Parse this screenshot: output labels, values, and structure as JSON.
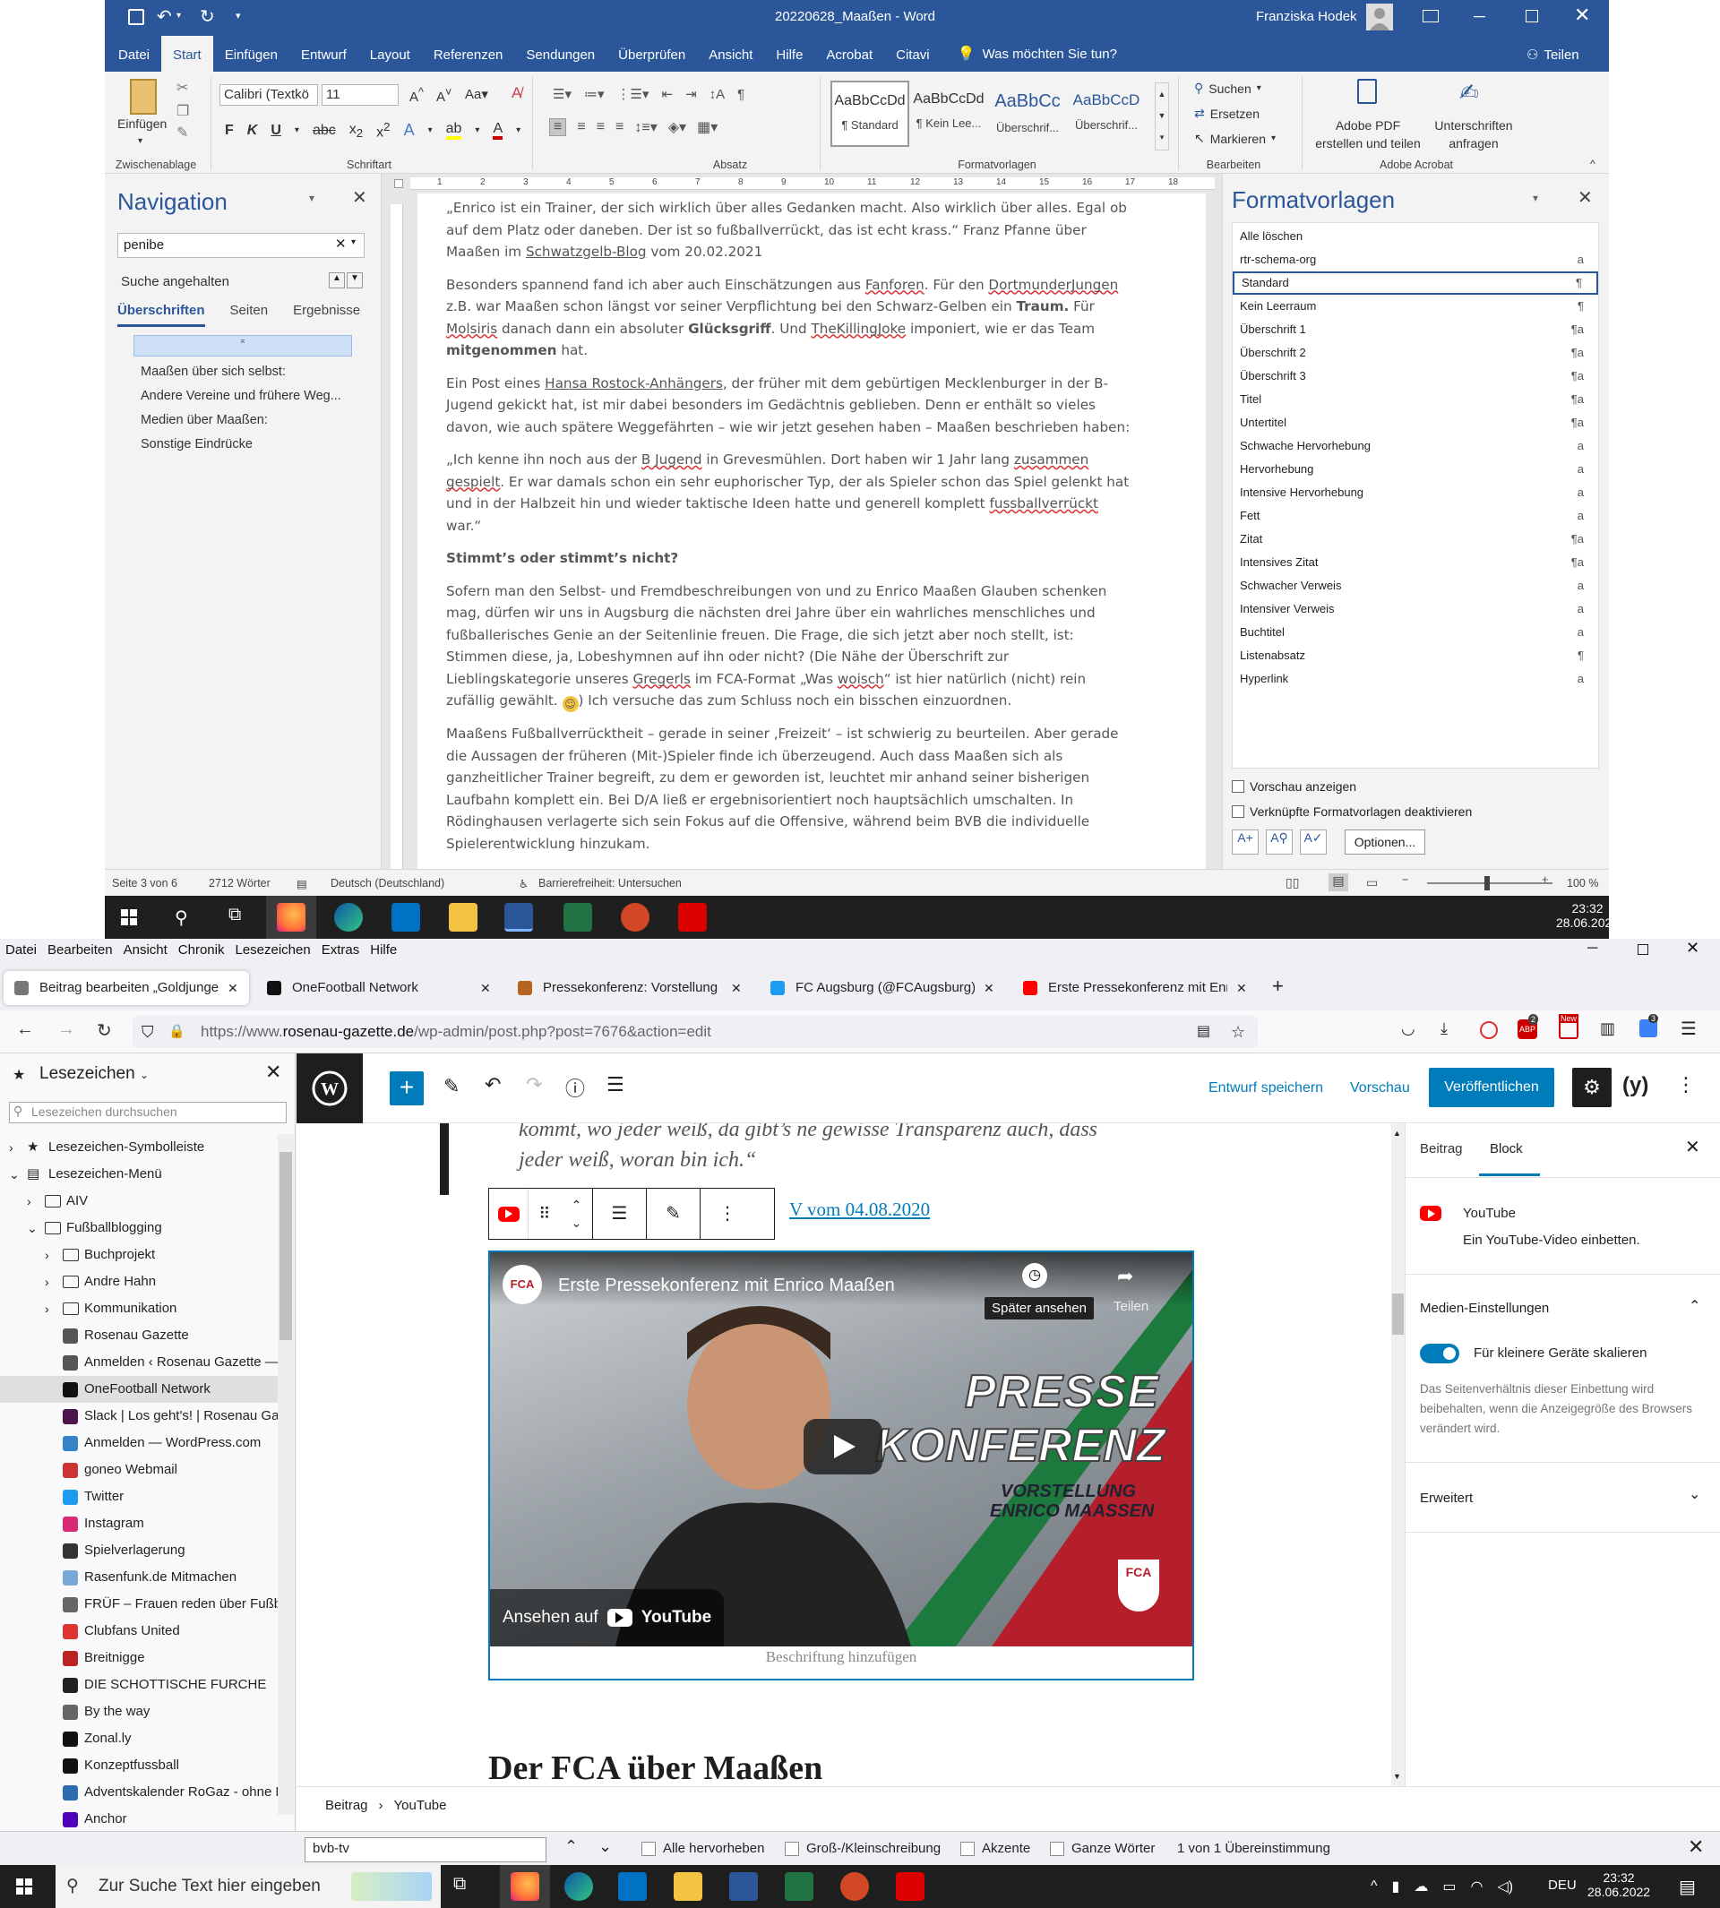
{
  "word": {
    "title": "20220628_Maaßen  -  Word",
    "user": "Franziska Hodek",
    "menu_tabs": [
      "Datei",
      "Start",
      "Einfügen",
      "Entwurf",
      "Layout",
      "Referenzen",
      "Sendungen",
      "Überprüfen",
      "Ansicht",
      "Hilfe",
      "Acrobat",
      "Citavi"
    ],
    "tell_me": "Was möchten Sie tun?",
    "share": "Teilen",
    "ribbon": {
      "paste": "Einfügen",
      "clipboard": "Zwischenablage",
      "font_name": "Calibri (Textkö",
      "font_size": "11",
      "font_group": "Schriftart",
      "paragraph_group": "Absatz",
      "styles_group": "Formatvorlagen",
      "styles": [
        {
          "sample": "AaBbCcDd",
          "name": "¶ Standard"
        },
        {
          "sample": "AaBbCcDd",
          "name": "¶ Kein Lee..."
        },
        {
          "sample": "AaBbCc",
          "name": "Überschrif..."
        },
        {
          "sample": "AaBbCcD",
          "name": "Überschrif..."
        }
      ],
      "search": "Suchen",
      "replace": "Ersetzen",
      "select": "Markieren",
      "edit_group": "Bearbeiten",
      "adobe_pdf": "Adobe PDF erstellen und teilen",
      "sign": "Unterschriften anfragen",
      "acrobat_group": "Adobe Acrobat"
    },
    "nav": {
      "title": "Navigation",
      "search_value": "penibe",
      "stopped": "Suche angehalten",
      "tabs": [
        "Überschriften",
        "Seiten",
        "Ergebnisse"
      ],
      "headings": [
        "Maaßen über sich selbst:",
        "Andere Vereine und frühere Weg...",
        "Medien über Maaßen:",
        "Sonstige Eindrücke"
      ]
    },
    "ruler_marks": [
      "1",
      "2",
      "3",
      "4",
      "5",
      "6",
      "7",
      "8",
      "9",
      "10",
      "11",
      "12",
      "13",
      "14",
      "15",
      "16",
      "17",
      "18"
    ],
    "doc": {
      "p1": "„Enrico ist ein Trainer, der sich wirklich über alles Gedanken macht. Also wirklich über alles. Egal ob auf dem Platz oder daneben. Der ist so fußballverrückt, das ist echt krass.“ Franz Pfanne über Maaßen im",
      "p1_link": "Schwatzgelb-Blog",
      "p1_end": "vom 20.02.2021",
      "p2a": "Besonders spannend fand ich aber auch Einschätzungen aus",
      "p2b": "Fanforen",
      "p2c": ". Für den",
      "p2d": "DortmunderJungen",
      "p2e": "z.B. war Maaßen schon längst vor seiner Verpflichtung bei den Schwarz-Gelben ein",
      "p2f": "Traum.",
      "p2g": "Für",
      "p2h": "Molsiris",
      "p2i": "danach dann ein absoluter",
      "p2j": "Glücksgriff",
      "p2k": ". Und",
      "p2l": "TheKillingJoke",
      "p2m": "imponiert, wie er das Team",
      "p2n": "mitgenommen",
      "p2o": "hat.",
      "p3a": "Ein Post eines",
      "p3b": "Hansa Rostock-Anhängers",
      "p3c": ", der früher mit dem gebürtigen Mecklenburger in der B-Jugend gekickt hat, ist mir dabei besonders im Gedächtnis geblieben. Denn er enthält so vieles davon, wie auch spätere Weggefährten – wie wir jetzt gesehen haben – Maaßen beschrieben haben:",
      "p4a": "„Ich kenne ihn noch aus der",
      "p4b": "B Jugend",
      "p4c": "in Grevesmühlen. Dort haben wir 1 Jahr lang",
      "p4d": "zusammen gespielt",
      "p4e": ". Er war damals schon ein sehr euphorischer Typ, der als Spieler schon das Spiel gelenkt hat und in der Halbzeit hin und wieder taktische Ideen hatte und generell komplett",
      "p4f": "fussballverrückt",
      "p4g": "war.“",
      "h": "Stimmt’s oder stimmt’s nicht?",
      "p5a": "Sofern man den Selbst- und Fremdbeschreibungen von und zu Enrico Maaßen Glauben schenken mag, dürfen wir uns in Augsburg die nächsten drei Jahre über ein wahrliches menschliches und fußballerisches Genie an der Seitenlinie freuen. Die Frage, die sich jetzt aber noch stellt, ist: Stimmen diese, ja, Lobeshymnen auf ihn oder nicht? (Die Nähe der Überschrift zur Lieblingskategorie unseres",
      "p5b": "Gregerls",
      "p5c": "im FCA-Format „Was",
      "p5d": "woisch",
      "p5e": "“ ist hier natürlich (nicht) rein zufällig gewählt.",
      "p5f": ") Ich versuche das zum Schluss noch ein bisschen einzuordnen.",
      "p6": "Maaßens Fußballverrücktheit – gerade in seiner ‚Freizeit‘ – ist schwierig zu beurteilen. Aber gerade die Aussagen der früheren (Mit-)Spieler finde ich überzeugend. Auch dass Maaßen sich als ganzheitlicher Trainer begreift, zu dem er geworden ist, leuchtet mir anhand seiner bisherigen Laufbahn komplett ein. Bei D/A ließ er ergebnisorientiert noch hauptsächlich umschalten. In Rödinghausen verlagerte sich sein Fokus auf die Offensive, während beim BVB die individuelle Spielerentwicklung hinzukam."
    },
    "styles_pane": {
      "title": "Formatvorlagen",
      "items": [
        {
          "name": "Alle löschen",
          "mark": ""
        },
        {
          "name": "rtr-schema-org",
          "mark": "a"
        },
        {
          "name": "Standard",
          "mark": "¶"
        },
        {
          "name": "Kein Leerraum",
          "mark": "¶"
        },
        {
          "name": "Überschrift 1",
          "mark": "¶a"
        },
        {
          "name": "Überschrift 2",
          "mark": "¶a"
        },
        {
          "name": "Überschrift 3",
          "mark": "¶a"
        },
        {
          "name": "Titel",
          "mark": "¶a"
        },
        {
          "name": "Untertitel",
          "mark": "¶a"
        },
        {
          "name": "Schwache Hervorhebung",
          "mark": "a"
        },
        {
          "name": "Hervorhebung",
          "mark": "a"
        },
        {
          "name": "Intensive Hervorhebung",
          "mark": "a"
        },
        {
          "name": "Fett",
          "mark": "a"
        },
        {
          "name": "Zitat",
          "mark": "¶a"
        },
        {
          "name": "Intensives Zitat",
          "mark": "¶a"
        },
        {
          "name": "Schwacher Verweis",
          "mark": "a"
        },
        {
          "name": "Intensiver Verweis",
          "mark": "a"
        },
        {
          "name": "Buchtitel",
          "mark": "a"
        },
        {
          "name": "Listenabsatz",
          "mark": "¶"
        },
        {
          "name": "Hyperlink",
          "mark": "a"
        }
      ],
      "preview": "Vorschau anzeigen",
      "linked": "Verknüpfte Formatvorlagen deaktivieren",
      "options": "Optionen..."
    },
    "status": {
      "page": "Seite 3 von 6",
      "words": "2712 Wörter",
      "lang": "Deutsch (Deutschland)",
      "access": "Barrierefreiheit: Untersuchen",
      "zoom": "100 %"
    }
  },
  "taskbar1": {
    "time": "23:32",
    "date": "28.06.2022"
  },
  "firefox": {
    "menu": [
      "Datei",
      "Bearbeiten",
      "Ansicht",
      "Chronik",
      "Lesezeichen",
      "Extras",
      "Hilfe"
    ],
    "tabs": [
      "Beitrag bearbeiten „Goldjunge",
      "OneFootball Network",
      "Pressekonferenz: Vorstellung En",
      "FC Augsburg (@FCAugsburg) /",
      "Erste Pressekonferenz mit Enrico"
    ],
    "url_prefix": "https://www.",
    "url_domain": "rosenau-gazette.de",
    "url_path": "/wp-admin/post.php?post=7676&action=edit",
    "badges": {
      "abp": "2",
      "news": "New",
      "ext": "3"
    },
    "bookmarks": {
      "title": "Lesezeichen",
      "search_placeholder": "Lesezeichen durchsuchen",
      "items": [
        {
          "label": "Lesezeichen-Symbolleiste",
          "indent": 0,
          "type": "star",
          "arrow": "›"
        },
        {
          "label": "Lesezeichen-Menü",
          "indent": 0,
          "type": "menu",
          "arrow": "⌄"
        },
        {
          "label": "AIV",
          "indent": 1,
          "type": "folder",
          "arrow": "›"
        },
        {
          "label": "Fußballblogging",
          "indent": 1,
          "type": "folder",
          "arrow": "⌄"
        },
        {
          "label": "Buchprojekt",
          "indent": 2,
          "type": "folder",
          "arrow": "›"
        },
        {
          "label": "Andre Hahn",
          "indent": 2,
          "type": "folder",
          "arrow": "›"
        },
        {
          "label": "Kommunikation",
          "indent": 2,
          "type": "folder",
          "arrow": "›"
        },
        {
          "label": "Rosenau Gazette",
          "indent": 2,
          "type": "fav",
          "color": "#555",
          "arrow": ""
        },
        {
          "label": "Anmelden ‹ Rosenau Gazette —",
          "indent": 2,
          "type": "fav",
          "color": "#555",
          "arrow": ""
        },
        {
          "label": "OneFootball Network",
          "indent": 2,
          "type": "fav",
          "color": "#111",
          "arrow": ""
        },
        {
          "label": "Slack | Los geht's! | Rosenau Gaz",
          "indent": 2,
          "type": "fav",
          "color": "#4a154b",
          "arrow": ""
        },
        {
          "label": "Anmelden — WordPress.com",
          "indent": 2,
          "type": "fav",
          "color": "#3582c4",
          "arrow": ""
        },
        {
          "label": "goneo Webmail",
          "indent": 2,
          "type": "fav",
          "color": "#c33",
          "arrow": ""
        },
        {
          "label": "Twitter",
          "indent": 2,
          "type": "fav",
          "color": "#1d9bf0",
          "arrow": ""
        },
        {
          "label": "Instagram",
          "indent": 2,
          "type": "fav",
          "color": "#d62976",
          "arrow": ""
        },
        {
          "label": "Spielverlagerung",
          "indent": 2,
          "type": "fav",
          "color": "#333",
          "arrow": ""
        },
        {
          "label": "Rasenfunk.de Mitmachen",
          "indent": 2,
          "type": "fav",
          "color": "#7aa7d8",
          "arrow": ""
        },
        {
          "label": "FRÜF – Frauen reden über Fußba",
          "indent": 2,
          "type": "fav",
          "color": "#666",
          "arrow": ""
        },
        {
          "label": "Clubfans United",
          "indent": 2,
          "type": "fav",
          "color": "#d33",
          "arrow": ""
        },
        {
          "label": "Breitnigge",
          "indent": 2,
          "type": "fav",
          "color": "#b22",
          "arrow": ""
        },
        {
          "label": "DIE SCHOTTISCHE FURCHE",
          "indent": 2,
          "type": "fav",
          "color": "#222",
          "arrow": ""
        },
        {
          "label": "By the way",
          "indent": 2,
          "type": "fav",
          "color": "#666",
          "arrow": ""
        },
        {
          "label": "Zonal.ly",
          "indent": 2,
          "type": "fav",
          "color": "#111",
          "arrow": ""
        },
        {
          "label": "Konzeptfussball",
          "indent": 2,
          "type": "fav",
          "color": "#111",
          "arrow": ""
        },
        {
          "label": "Adventskalender RoGaz - ohne L",
          "indent": 2,
          "type": "fav",
          "color": "#2b6cb0",
          "arrow": ""
        },
        {
          "label": "Anchor",
          "indent": 2,
          "type": "fav",
          "color": "#5000b9",
          "arrow": ""
        }
      ]
    },
    "wp": {
      "save_draft": "Entwurf speichern",
      "preview": "Vorschau",
      "publish": "Veröffentlichen",
      "quote_line1": "kommt, wo jeder weiß, da gibt’s ne gewisse Transparenz auch, dass",
      "quote_line2": "jeder weiß, woran bin ich.“",
      "link_text": "V vom 04.08.2020",
      "video": {
        "title": "Erste Pressekonferenz mit Enrico Maaßen",
        "watch_later": "Später ansehen",
        "share": "Teilen",
        "presse": "PRESSE",
        "konferenz": "KONFERENZ",
        "vorstellung": "VORSTELLUNG",
        "name": "ENRICO MAASSEN",
        "watch_on": "Ansehen auf",
        "youtube": "YouTube",
        "fca": "FCA"
      },
      "caption_placeholder": "Beschriftung hinzufügen",
      "next_heading": "Der FCA über Maaßen",
      "sidebar": {
        "tab_post": "Beitrag",
        "tab_block": "Block",
        "block_name": "YouTube",
        "block_desc": "Ein YouTube-Video einbetten.",
        "media_settings": "Medien-Einstellungen",
        "toggle_label": "Für kleinere Geräte skalieren",
        "help": "Das Seitenverhältnis dieser Einbettung wird beibehalten, wenn die Anzeigegröße des Browsers verändert wird.",
        "advanced": "Erweitert"
      },
      "crumbs": [
        "Beitrag",
        "YouTube"
      ]
    },
    "find": {
      "value": "bvb-tv",
      "highlight_all": "Alle hervorheben",
      "match_case": "Groß-/Kleinschreibung",
      "accents": "Akzente",
      "whole_words": "Ganze Wörter",
      "result": "1 von 1 Übereinstimmung"
    }
  },
  "taskbar2": {
    "search_placeholder": "Zur Suche Text hier eingeben",
    "lang": "DEU",
    "time": "23:32",
    "date": "28.06.2022"
  },
  "colors": {
    "word_blue": "#2b579a",
    "wp_blue": "#007cba",
    "yt_red": "#ff0000",
    "taskbar": "#1f1f1f"
  }
}
